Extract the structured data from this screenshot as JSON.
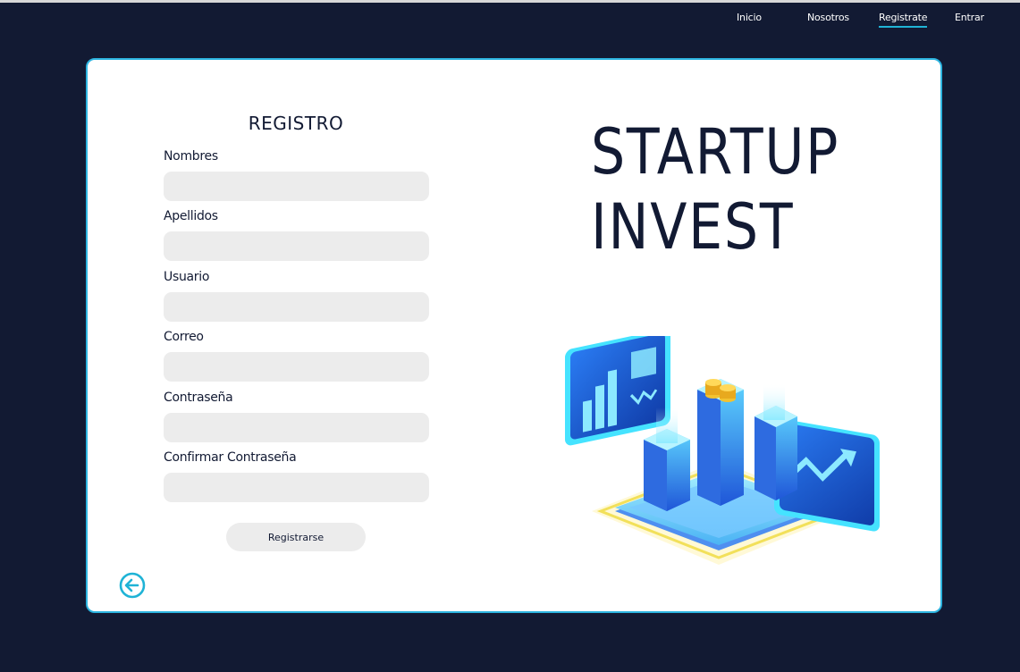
{
  "nav": {
    "items": [
      {
        "label": "Inicio",
        "active": false
      },
      {
        "label": "Nosotros",
        "active": false
      },
      {
        "label": "Registrate",
        "active": true
      },
      {
        "label": "Entrar",
        "active": false
      }
    ]
  },
  "form": {
    "title": "REGISTRO",
    "fields": [
      {
        "label": "Nombres",
        "value": "",
        "placeholder": ""
      },
      {
        "label": "Apellidos",
        "value": "",
        "placeholder": ""
      },
      {
        "label": "Usuario",
        "value": "",
        "placeholder": ""
      },
      {
        "label": "Correo",
        "value": "",
        "placeholder": ""
      },
      {
        "label": "Contraseña",
        "value": "",
        "placeholder": ""
      },
      {
        "label": "Confirmar Contraseña",
        "value": "",
        "placeholder": ""
      }
    ],
    "submit_label": "Registrarse"
  },
  "brand": {
    "line1": "STARTUP",
    "line2": "INVEST"
  },
  "icons": {
    "back": "arrow-left-circle-icon",
    "illustration": "isometric-investment-chart-illustration"
  },
  "colors": {
    "background": "#121a33",
    "accent": "#2cb4e0",
    "card": "#ffffff",
    "input": "#ececec"
  }
}
